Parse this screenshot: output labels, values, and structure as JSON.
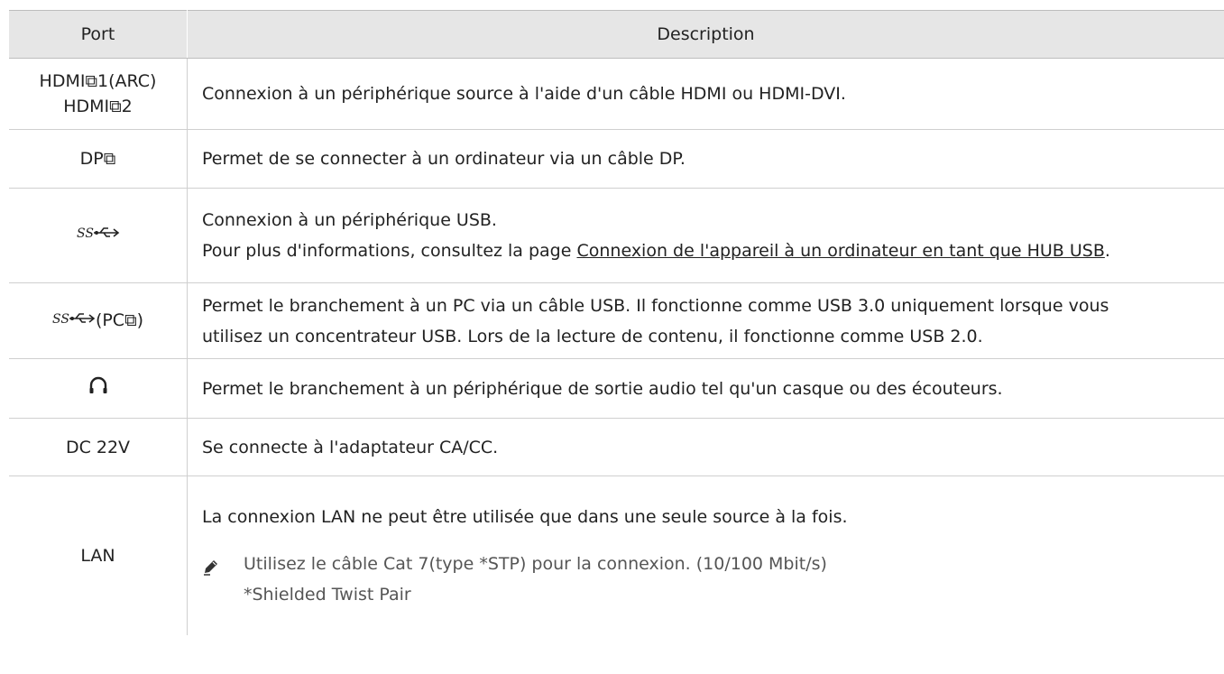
{
  "table": {
    "headers": {
      "port": "Port",
      "description": "Description"
    },
    "rows": [
      {
        "port_line1": "HDMI⧉1(ARC)",
        "port_line2": "HDMI⧉2",
        "desc": "Connexion à un périphérique source à l'aide d'un câble HDMI ou HDMI-DVI."
      },
      {
        "port": "DP⧉",
        "desc": "Permet de se connecter à un ordinateur via un câble DP."
      },
      {
        "port_icon": "usb-ss-icon",
        "desc_line1": "Connexion à un périphérique USB.",
        "desc_prefix": "Pour plus d'informations, consultez la page ",
        "desc_link": "Connexion de l'appareil à un ordinateur en tant que HUB USB",
        "desc_suffix": "."
      },
      {
        "port_icon": "usb-ss-icon",
        "port_suffix": "(PC⧉)",
        "desc_line1": "Permet le branchement à un PC via un câble USB. Il fonctionne comme USB 3.0 uniquement lorsque vous",
        "desc_line2": "utilisez un concentrateur USB. Lors de la lecture de contenu, il fonctionne comme USB 2.0."
      },
      {
        "port_icon": "headphones-icon",
        "desc": "Permet le branchement à un périphérique de sortie audio tel qu'un casque ou des écouteurs."
      },
      {
        "port": "DC 22V",
        "desc": "Se connecte à l'adaptateur CA/CC."
      },
      {
        "port": "LAN",
        "desc_line1": "La connexion LAN ne peut être utilisée que dans une seule source à la fois.",
        "note": "Utilisez le câble Cat 7(type *STP) pour la connexion. (10/100 Mbit/s)",
        "note_sub": "*Shielded Twist Pair"
      }
    ]
  }
}
